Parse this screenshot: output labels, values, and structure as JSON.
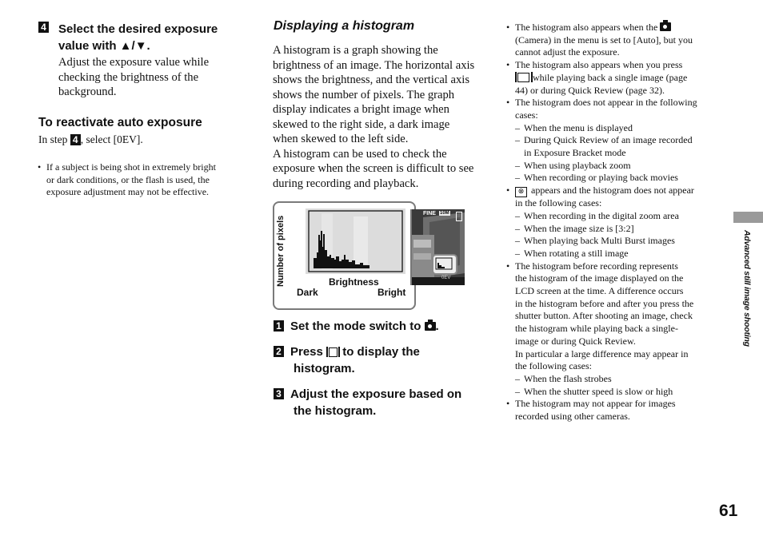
{
  "left_column": {
    "step4": {
      "number": "4",
      "title_line1": "Select the desired exposure",
      "title_line2": "value with ▲/▼.",
      "body": [
        "Adjust the exposure value while",
        "checking the brightness of the",
        "background."
      ]
    },
    "reactivate": {
      "heading": "To reactivate auto exposure",
      "text_before": "In step ",
      "step_ref": "4",
      "text_after": ", select [0EV]."
    },
    "note": [
      "If a subject is being shot in extremely bright",
      "or dark conditions, or the flash is used, the",
      "exposure adjustment may not be effective."
    ]
  },
  "middle_column": {
    "heading": "Displaying a histogram",
    "paragraph": [
      "A histogram is a graph showing the",
      "brightness of an image. The horizontal axis",
      "shows the brightness, and the vertical axis",
      "shows the number of pixels. The graph",
      "display indicates a bright image when",
      "skewed to the right side, a dark image",
      "when skewed to the left side.",
      "A histogram can be used to check the",
      "exposure when the screen is difficult to see",
      "during recording and playback."
    ],
    "figure": {
      "y_label": "Number of pixels",
      "x_label": "Brightness",
      "dark_label": "Dark",
      "bright_label": "Bright",
      "lcd_quality": "FINE",
      "lcd_size": "10M",
      "lcd_ev": "0EV"
    },
    "steps": [
      {
        "number": "1",
        "line1": "Set the mode switch to",
        "icon": "camera-icon",
        "line1_end": "."
      },
      {
        "number": "2",
        "line1_pre": "Press",
        "icon": "display-button-icon",
        "line1_post": "to display the",
        "line2": "histogram."
      },
      {
        "number": "3",
        "line1": "Adjust the exposure based on",
        "line2": "the histogram."
      }
    ]
  },
  "right_column": {
    "notes": [
      {
        "lines": [
          "The histogram also appears when the",
          "(Camera) in the menu is set to [Auto], but you",
          "cannot adjust the exposure."
        ]
      },
      {
        "lines": [
          "The histogram also appears when you press",
          "while playing back a single image (page",
          "44) or during Quick Review (page 32)."
        ]
      },
      {
        "lines": [
          "The histogram does not appear in the following",
          "cases:"
        ],
        "dashes": [
          "When the menu is displayed",
          "During Quick Review of an image recorded",
          "in Exposure Bracket mode",
          "When using playback zoom",
          "When recording or playing back movies"
        ]
      },
      {
        "lines": [
          "appears and the histogram does not appear",
          "in the following cases:"
        ],
        "dashes": [
          "When recording in the digital zoom area",
          "When the image size is [3:2]",
          "When playing back Multi Burst images",
          "When rotating a still image"
        ]
      },
      {
        "lines": [
          "The histogram before recording represents",
          "the histogram of the image displayed on the",
          "LCD screen at the time. A difference occurs",
          "in the histogram before and after you press the",
          "shutter button. After shooting an image, check",
          "the histogram while playing back a single-",
          "image or during Quick Review.",
          "In particular a large difference may appear in",
          "the following cases:"
        ],
        "dashes": [
          "When the flash strobes",
          "When the shutter speed is slow or high"
        ]
      },
      {
        "lines": [
          "The histogram may not appear for images",
          "recorded using other cameras."
        ]
      }
    ]
  },
  "side_tab": {
    "label": "Advanced still image shooting"
  },
  "page_number": "61"
}
